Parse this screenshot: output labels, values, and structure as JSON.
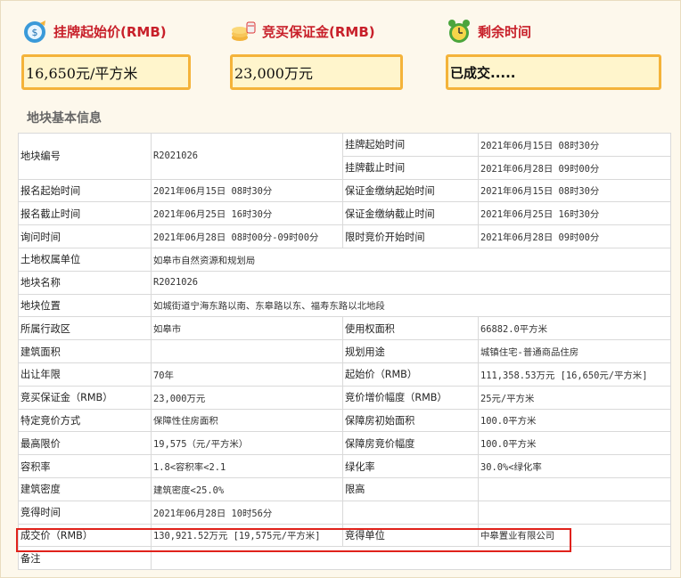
{
  "stats": [
    {
      "label": "挂牌起始价(RMB)",
      "value": "16,650元/平方米",
      "icon": "money-bag-icon"
    },
    {
      "label": "竞买保证金(RMB)",
      "value": "23,000万元",
      "icon": "coins-icon"
    },
    {
      "label": "剩余时间",
      "value": "已成交.....",
      "icon": "alarm-clock-icon"
    }
  ],
  "section_title": "地块基本信息",
  "rows": {
    "r1": {
      "k1": "地块编号",
      "v1": "R2021026",
      "k2a": "挂牌起始时间",
      "v2a": "2021年06月15日 08时30分",
      "k2b": "挂牌截止时间",
      "v2b": "2021年06月28日 09时00分"
    },
    "r2": {
      "k1": "报名起始时间",
      "v1": "2021年06月15日 08时30分",
      "k2": "保证金缴纳起始时间",
      "v2": "2021年06月15日 08时30分"
    },
    "r3": {
      "k1": "报名截止时间",
      "v1": "2021年06月25日 16时30分",
      "k2": "保证金缴纳截止时间",
      "v2": "2021年06月25日 16时30分"
    },
    "r4": {
      "k1": "询问时间",
      "v1": "2021年06月28日 08时00分-09时00分",
      "k2": "限时竞价开始时间",
      "v2": "2021年06月28日 09时00分"
    },
    "r5": {
      "k1": "土地权属单位",
      "v1": "如皋市自然资源和规划局"
    },
    "r6": {
      "k1": "地块名称",
      "v1": "R2021026"
    },
    "r7": {
      "k1": "地块位置",
      "v1": "如城街道宁海东路以南、东皋路以东、福寿东路以北地段"
    },
    "r8": {
      "k1": "所属行政区",
      "v1": "如皋市",
      "k2": "使用权面积",
      "v2": "66882.0平方米"
    },
    "r9": {
      "k1": "建筑面积",
      "v1": "",
      "k2": "规划用途",
      "v2": "城镇住宅-普通商品住房"
    },
    "r10": {
      "k1": "出让年限",
      "v1": "70年",
      "k2": "起始价（RMB）",
      "v2": "111,358.53万元 [16,650元/平方米]"
    },
    "r11": {
      "k1": "竞买保证金（RMB）",
      "v1": "23,000万元",
      "k2": "竞价增价幅度（RMB）",
      "v2": "25元/平方米"
    },
    "r12": {
      "k1": "特定竞价方式",
      "v1": "保障性住房面积",
      "k2": "保障房初始面积",
      "v2": "100.0平方米"
    },
    "r13": {
      "k1": "最高限价",
      "v1": "19,575（元/平方米）",
      "k2": "保障房竞价幅度",
      "v2": "100.0平方米"
    },
    "r14": {
      "k1": "容积率",
      "v1": "1.8<容积率<2.1",
      "k2": "绿化率",
      "v2": "30.0%<绿化率"
    },
    "r15": {
      "k1": "建筑密度",
      "v1": "建筑密度<25.0%",
      "k2": "限高",
      "v2": ""
    },
    "r16": {
      "k1": "竞得时间",
      "v1": "2021年06月28日 10时56分",
      "k2": "",
      "v2": ""
    },
    "r17": {
      "k1": "成交价（RMB）",
      "v1": "130,921.52万元 [19,575元/平方米]",
      "k2": "竞得单位",
      "v2": "中皋置业有限公司"
    },
    "r18": {
      "k1": "备注",
      "v1": ""
    }
  }
}
